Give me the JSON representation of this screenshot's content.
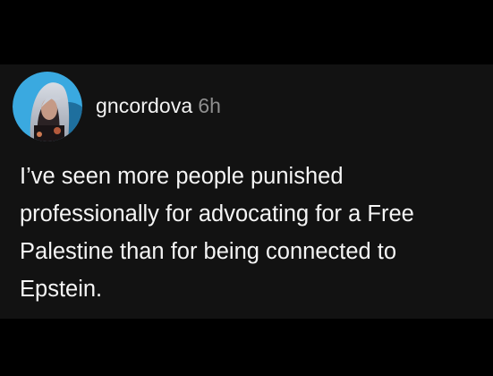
{
  "post": {
    "username": "gncordova",
    "timestamp": "6h",
    "text": "I’ve seen more people punished\nprofessionally for advocating for a Free\nPalestine than for being connected to\nEpstein.",
    "avatar_icon": "profile-photo",
    "ring_color": "#3aa9e0"
  }
}
